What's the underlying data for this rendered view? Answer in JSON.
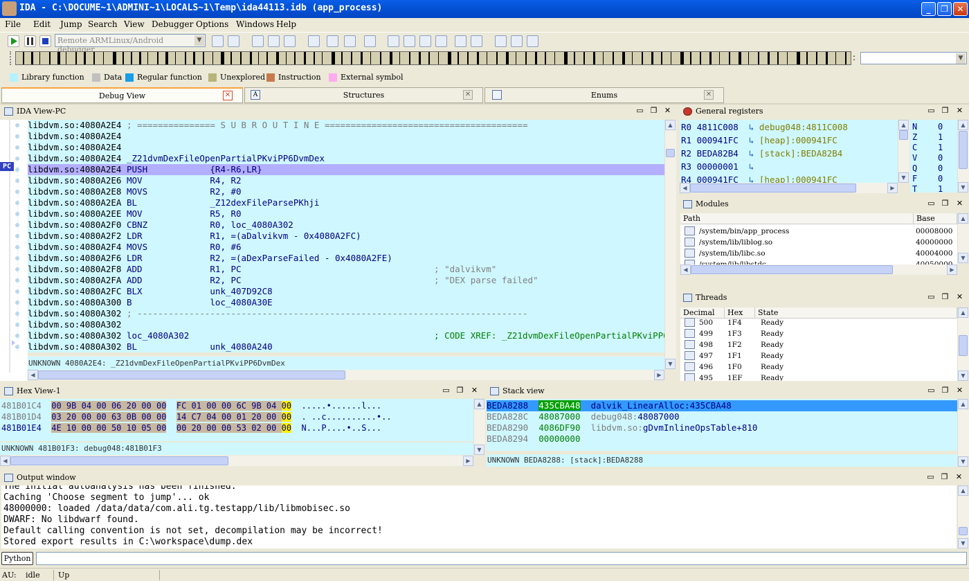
{
  "window": {
    "title": "IDA - C:\\DOCUME~1\\ADMINI~1\\LOCALS~1\\Temp\\ida44113.idb (app_process)"
  },
  "menu": [
    "File",
    "Edit",
    "Jump",
    "Search",
    "View",
    "Debugger",
    "Options",
    "Windows",
    "Help"
  ],
  "toolbar": {
    "debugger_select": "Remote ARMLinux/Android debugger"
  },
  "legend": [
    {
      "label": "Library function",
      "color": "#b4f2ff"
    },
    {
      "label": "Data",
      "color": "#c0c0c0"
    },
    {
      "label": "Regular function",
      "color": "#189ee8"
    },
    {
      "label": "Unexplored",
      "color": "#b8b47a"
    },
    {
      "label": "Instruction",
      "color": "#c87a4c"
    },
    {
      "label": "External symbol",
      "color": "#ffaaee"
    }
  ],
  "tabs": [
    {
      "label": "Debug View",
      "active": true
    },
    {
      "label": "Structures",
      "active": false
    },
    {
      "label": "Enums",
      "active": false
    }
  ],
  "ida_view": {
    "title": "IDA View-PC",
    "pc_label": "PC",
    "lines": [
      {
        "addr": "libdvm.so:4080A2E4",
        "text": " ; =============== S U B R O U T I N E =======================================",
        "kind": "comment"
      },
      {
        "addr": "libdvm.so:4080A2E4",
        "text": "",
        "kind": "plain"
      },
      {
        "addr": "libdvm.so:4080A2E4",
        "text": "",
        "kind": "plain"
      },
      {
        "addr": "libdvm.so:4080A2E4",
        "text": " _Z21dvmDexFileOpenPartialPKviPP6DvmDex",
        "kind": "label"
      },
      {
        "addr": "libdvm.so:4080A2E4",
        "text": " PUSH            {R4-R6,LR}",
        "kind": "instr",
        "selected": true
      },
      {
        "addr": "libdvm.so:4080A2E6",
        "text": " MOV             R4, R2",
        "kind": "instr"
      },
      {
        "addr": "libdvm.so:4080A2E8",
        "text": " MOVS            R2, #0",
        "kind": "instr"
      },
      {
        "addr": "libdvm.so:4080A2EA",
        "text": " BL              _Z12dexFileParsePKhji",
        "kind": "instr"
      },
      {
        "addr": "libdvm.so:4080A2EE",
        "text": " MOV             R5, R0",
        "kind": "instr"
      },
      {
        "addr": "libdvm.so:4080A2F0",
        "text": " CBNZ            R0, loc_4080A302",
        "kind": "instr"
      },
      {
        "addr": "libdvm.so:4080A2F2",
        "text": " LDR             R1, =(aDalvikvm - 0x4080A2FC)",
        "kind": "instr"
      },
      {
        "addr": "libdvm.so:4080A2F4",
        "text": " MOVS            R0, #6",
        "kind": "instr"
      },
      {
        "addr": "libdvm.so:4080A2F6",
        "text": " LDR             R2, =(aDexParseFailed - 0x4080A2FE)",
        "kind": "instr"
      },
      {
        "addr": "libdvm.so:4080A2F8",
        "text": " ADD             R1, PC",
        "kind": "instr",
        "comment": "; \"dalvikvm\""
      },
      {
        "addr": "libdvm.so:4080A2FA",
        "text": " ADD             R2, PC",
        "kind": "instr",
        "comment": "; \"DEX parse failed\""
      },
      {
        "addr": "libdvm.so:4080A2FC",
        "text": " BLX             unk_407D92C8",
        "kind": "instr"
      },
      {
        "addr": "libdvm.so:4080A300",
        "text": " B               loc_4080A30E",
        "kind": "instr"
      },
      {
        "addr": "libdvm.so:4080A302",
        "text": " ; ---------------------------------------------------------------------------",
        "kind": "comment"
      },
      {
        "addr": "libdvm.so:4080A302",
        "text": "",
        "kind": "plain"
      },
      {
        "addr": "libdvm.so:4080A302",
        "text": " loc_4080A302",
        "kind": "label",
        "comment": "; CODE XREF: _Z21dvmDexFileOpenPartialPKviPP6DvmDex+C↑j"
      },
      {
        "addr": "libdvm.so:4080A302",
        "text": " BL              unk_4080A240",
        "kind": "instr"
      }
    ],
    "status": "UNKNOWN 4080A2E4: _Z21dvmDexFileOpenPartialPKviPP6DvmDex"
  },
  "registers": {
    "title": "General registers",
    "rows": [
      {
        "name": "R0",
        "value": "4811C008",
        "ref": "debug048:4811C008"
      },
      {
        "name": "R1",
        "value": "000941FC",
        "ref": "[heap]:000941FC"
      },
      {
        "name": "R2",
        "value": "BEDA82B4",
        "ref": "[stack]:BEDA82B4"
      },
      {
        "name": "R3",
        "value": "00000001",
        "ref": ""
      },
      {
        "name": "R4",
        "value": "000941FC",
        "ref": "[heap]:000941FC"
      }
    ],
    "flags": [
      {
        "name": "N",
        "value": "0"
      },
      {
        "name": "Z",
        "value": "1"
      },
      {
        "name": "C",
        "value": "1"
      },
      {
        "name": "V",
        "value": "0"
      },
      {
        "name": "Q",
        "value": "0"
      },
      {
        "name": "F",
        "value": "0"
      },
      {
        "name": "T",
        "value": "1"
      }
    ]
  },
  "modules": {
    "title": "Modules",
    "columns": [
      "Path",
      "Base"
    ],
    "rows": [
      {
        "path": "/system/bin/app_process",
        "base": "00008000"
      },
      {
        "path": "/system/lib/liblog.so",
        "base": "40000000"
      },
      {
        "path": "/system/lib/libc.so",
        "base": "40004000"
      },
      {
        "path": "/system/lib/libstdc...",
        "base": "40050000"
      }
    ]
  },
  "threads": {
    "title": "Threads",
    "columns": [
      "Decimal",
      "Hex",
      "State"
    ],
    "rows": [
      {
        "dec": "500",
        "hex": "1F4",
        "state": "Ready"
      },
      {
        "dec": "499",
        "hex": "1F3",
        "state": "Ready"
      },
      {
        "dec": "498",
        "hex": "1F2",
        "state": "Ready"
      },
      {
        "dec": "497",
        "hex": "1F1",
        "state": "Ready"
      },
      {
        "dec": "496",
        "hex": "1F0",
        "state": "Ready"
      },
      {
        "dec": "495",
        "hex": "1EF",
        "state": "Ready"
      }
    ]
  },
  "hex_view": {
    "title": "Hex View-1",
    "rows": [
      {
        "addr": "481B01C4",
        "b1": "00 9B 04 00 06 20 00 00",
        "b2": "FC 01 00 00 6C 9B 04 00",
        "ascii": ".....•......l..."
      },
      {
        "addr": "481B01D4",
        "b1": "03 20 00 00 63 0B 00 00",
        "b2": "14 C7 04 00 01 20 00 00",
        "ascii": ". ..c..........•.."
      },
      {
        "addr": "481B01E4",
        "b1": "4E 10 00 00 50 10 05 00",
        "b2": "00 20 00 00 53 02 00 00",
        "ascii": "N...P....•..S..."
      }
    ],
    "status": "UNKNOWN 481B01F3: debug048:481B01F3"
  },
  "stack_view": {
    "title": "Stack view",
    "rows": [
      {
        "addr": "BEDA8288",
        "value": "435CBA48",
        "ref": "dalvik_LinearAlloc:435CBA48",
        "selected": true
      },
      {
        "addr": "BEDA828C",
        "value": "48087000",
        "ref": "debug048:48087000"
      },
      {
        "addr": "BEDA8290",
        "value": "4086DF90",
        "ref": "libdvm.so:gDvmInlineOpsTable+810"
      },
      {
        "addr": "BEDA8294",
        "value": "00000000",
        "ref": ""
      }
    ],
    "status": "UNKNOWN BEDA8288: [stack]:BEDA8288"
  },
  "output": {
    "title": "Output window",
    "lines": [
      "The initial autoanalysis has been finished.",
      "Caching 'Choose segment to jump'... ok",
      "48000000: loaded /data/data/com.ali.tg.testapp/lib/libmobisec.so",
      "DWARF: No libdwarf found.",
      "Default calling convention is not set, decompilation may be incorrect!",
      "Stored export results in C:\\workspace\\dump.dex"
    ]
  },
  "command": {
    "lang_button": "Python"
  },
  "statusbar": {
    "au_label": "AU:",
    "au_state": "idle",
    "direction": "Up"
  }
}
